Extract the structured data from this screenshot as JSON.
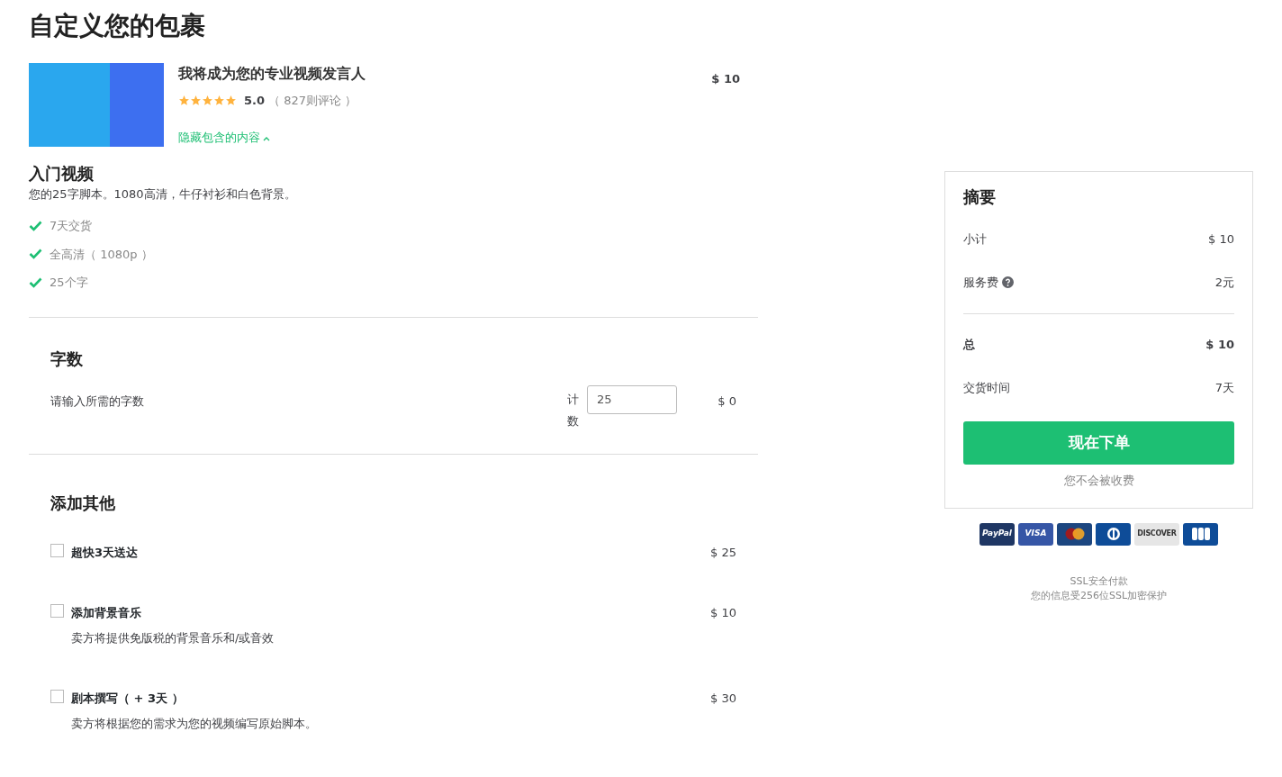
{
  "page_title": "自定义您的包裹",
  "gig": {
    "title": "我将成为您的专业视频发言人",
    "stars": 5,
    "rating": "5.0",
    "reviews": "（ 827则评论 ）",
    "price": "$ 10",
    "toggle": "隐藏包含的内容"
  },
  "package": {
    "name": "入门视频",
    "description": "您的25字脚本。1080高清，牛仔衬衫和白色背景。",
    "features": [
      "7天交货",
      "全高清（ 1080p ）",
      "25个字"
    ]
  },
  "word_count": {
    "heading": "字数",
    "prompt": "请输入所需的字数",
    "label": "计数",
    "value": "25",
    "price": "$ 0"
  },
  "extras": {
    "heading": "添加其他",
    "items": [
      {
        "title": "超快3天送达",
        "price": "$ 25",
        "checked": false
      },
      {
        "title": "添加背景音乐",
        "price": "$ 10",
        "checked": false,
        "description": "卖方将提供免版税的背景音乐和/或音效"
      },
      {
        "title": "剧本撰写（ + 3天 ）",
        "price": "$ 30",
        "checked": false,
        "description": "卖方将根据您的需求为您的视频编写原始脚本。"
      }
    ]
  },
  "summary": {
    "heading": "摘要",
    "rows": [
      {
        "label": "小计",
        "value": "$ 10",
        "kind": "plain"
      },
      {
        "label": "服务费",
        "value": "2元",
        "kind": "help"
      },
      {
        "label": "总",
        "value": "$ 10",
        "kind": "total"
      },
      {
        "label": "交货时间",
        "value": "7天",
        "kind": "plain"
      }
    ],
    "button": "现在下单",
    "note": "您不会被收费"
  },
  "payment_cards": [
    {
      "kind": "paypal",
      "label": "PayPal"
    },
    {
      "kind": "visa",
      "label": "VISA"
    },
    {
      "kind": "mastercard"
    },
    {
      "kind": "diners"
    },
    {
      "kind": "discover",
      "label": "DISCOVER"
    },
    {
      "kind": "jcb"
    }
  ],
  "security": {
    "title": "SSL安全付款",
    "text": "您的信息受256位SSL加密保护"
  }
}
